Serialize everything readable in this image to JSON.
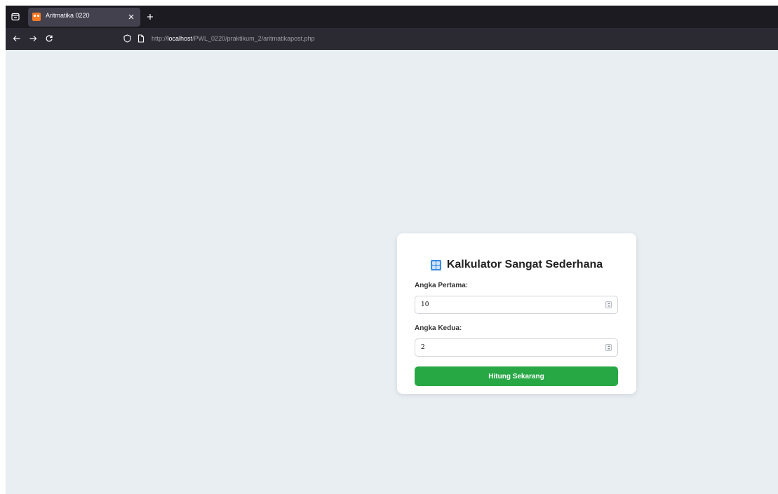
{
  "browser": {
    "tab": {
      "title": "Aritmatika 0220",
      "favicon": "xampp-favicon-icon"
    },
    "url": {
      "scheme": "http://",
      "host": "localhost",
      "path": "/PWL_0220/praktikum_2/aritmatikapost.php"
    },
    "icons": {
      "overview": "tab-overview-icon",
      "close": "close-icon",
      "new_tab": "plus-icon",
      "back": "arrow-left-icon",
      "forward": "arrow-right-icon",
      "reload": "reload-icon",
      "tracking": "shield-icon",
      "page": "page-icon"
    },
    "colors": {
      "tab_strip": "#1c1b22",
      "active_tab": "#42414d",
      "nav_bar": "#2b2a33"
    }
  },
  "page": {
    "background": "#e9eef2",
    "card": {
      "title": "Kalkulator Sangat Sederhana",
      "title_icon": "calculator-icon",
      "fields": [
        {
          "label": "Angka Pertama:",
          "value": "10"
        },
        {
          "label": "Angka Kedua:",
          "value": "2"
        }
      ],
      "submit_label": "Hitung Sekarang",
      "button_color": "#28a745"
    }
  }
}
